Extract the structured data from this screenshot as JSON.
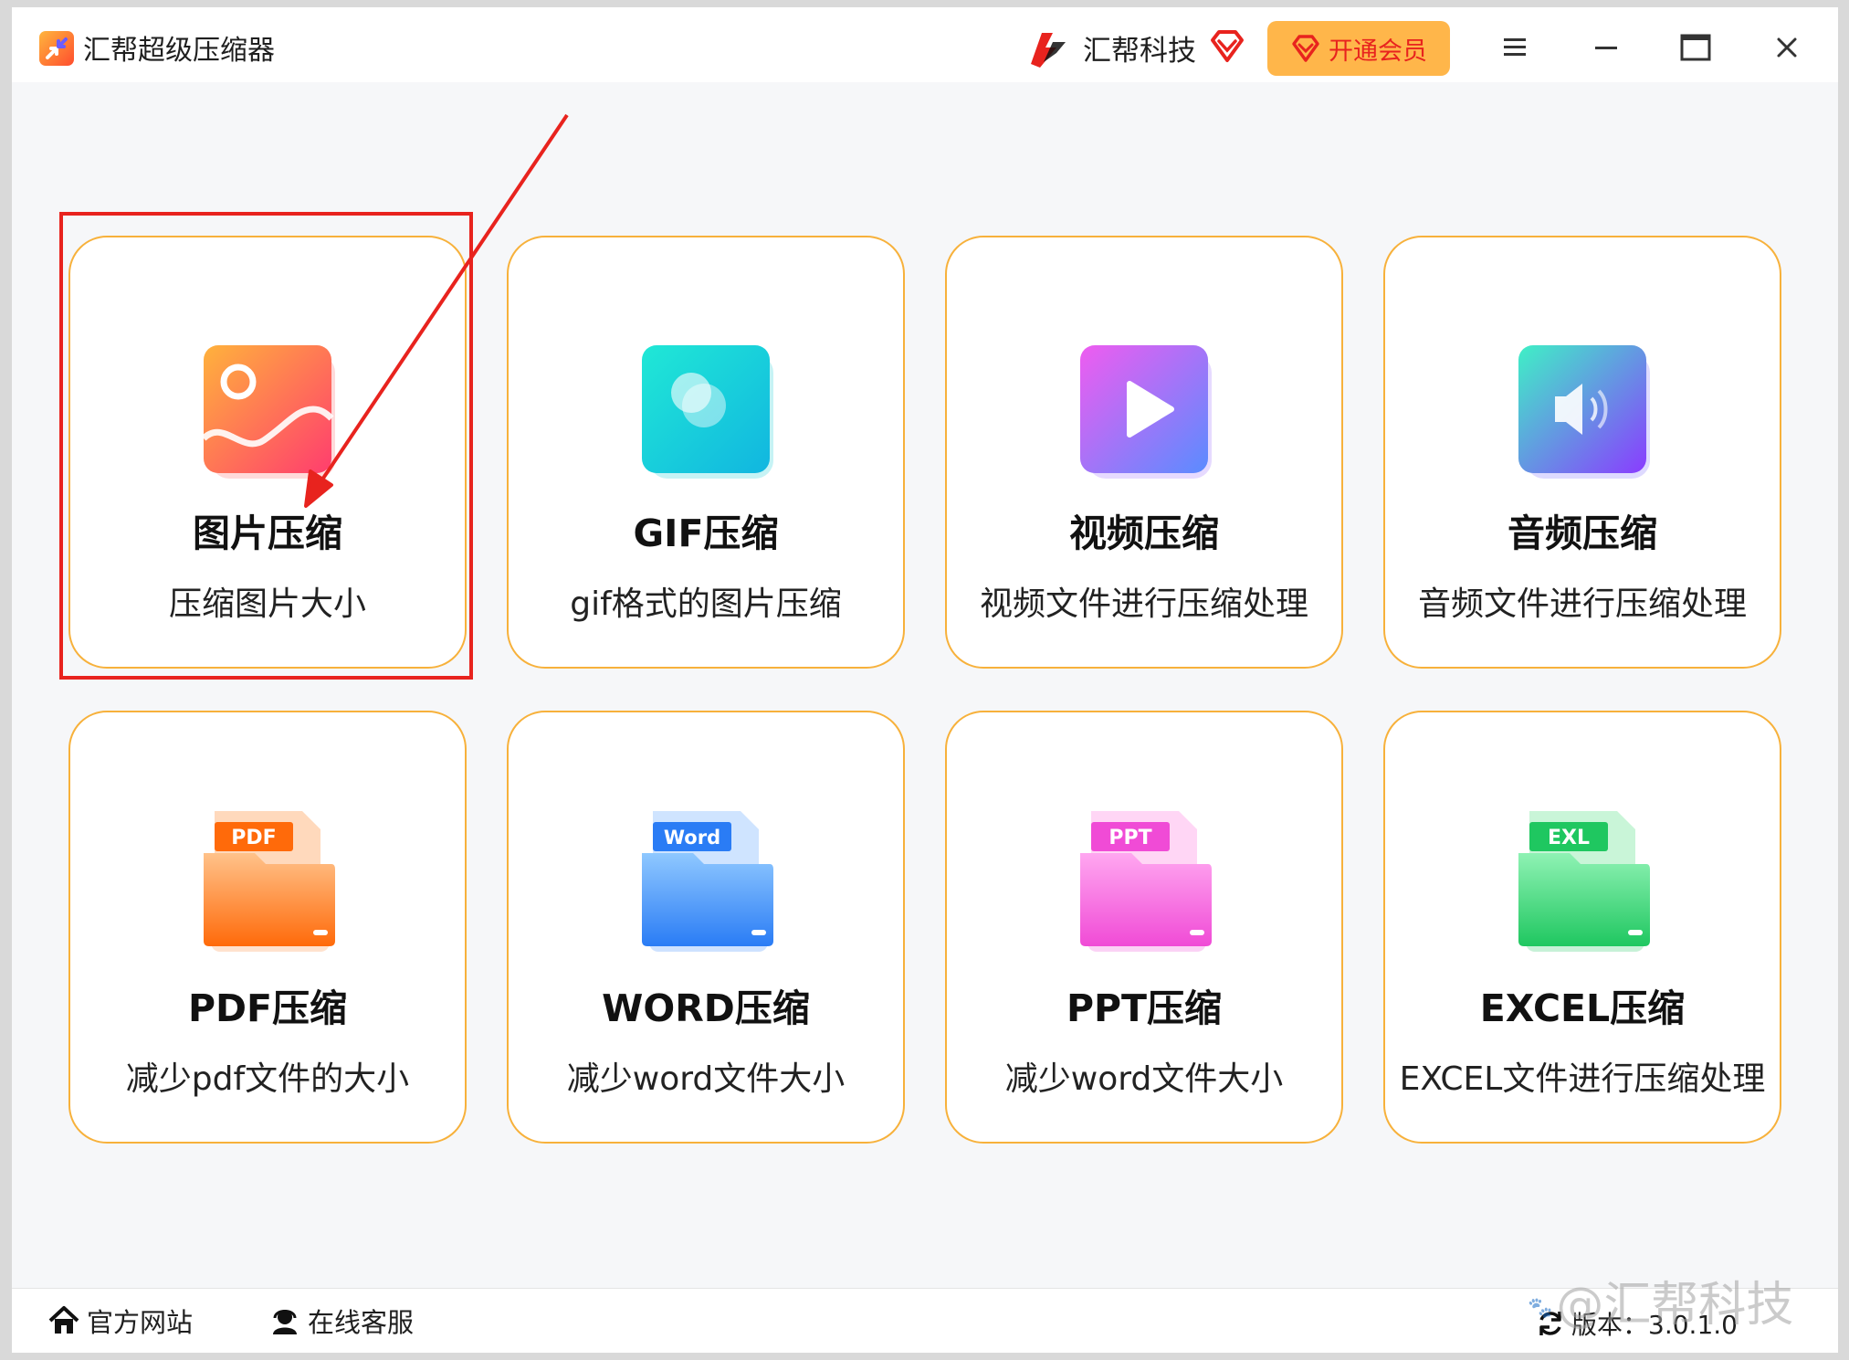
{
  "window": {
    "app_title": "汇帮超级压缩器",
    "brand_name": "汇帮科技",
    "vip_label": "开通会员"
  },
  "cards": [
    {
      "title": "图片压缩",
      "subtitle": "压缩图片大小",
      "icon": "image-icon"
    },
    {
      "title": "GIF压缩",
      "subtitle": "gif格式的图片压缩",
      "icon": "gif-icon"
    },
    {
      "title": "视频压缩",
      "subtitle": "视频文件进行压缩处理",
      "icon": "video-play-icon"
    },
    {
      "title": "音频压缩",
      "subtitle": "音频文件进行压缩处理",
      "icon": "speaker-icon"
    },
    {
      "title": "PDF压缩",
      "subtitle": "减少pdf文件的大小",
      "icon": "pdf-folder-icon",
      "badge": "PDF"
    },
    {
      "title": "WORD压缩",
      "subtitle": "减少word文件大小",
      "icon": "word-folder-icon",
      "badge": "Word"
    },
    {
      "title": "PPT压缩",
      "subtitle": "减少word文件大小",
      "icon": "ppt-folder-icon",
      "badge": "PPT"
    },
    {
      "title": "EXCEL压缩",
      "subtitle": "EXCEL文件进行压缩处理",
      "icon": "excel-folder-icon",
      "badge": "EXL"
    }
  ],
  "footer": {
    "website": "官方网站",
    "support": "在线客服",
    "version": "版本：3.0.1.0"
  },
  "watermark": "@汇帮科技",
  "colors": {
    "card_border": "#f7b13b",
    "vip_bg": "#ffb64a",
    "vip_text": "#e8231e",
    "annotation": "#e8231e"
  }
}
